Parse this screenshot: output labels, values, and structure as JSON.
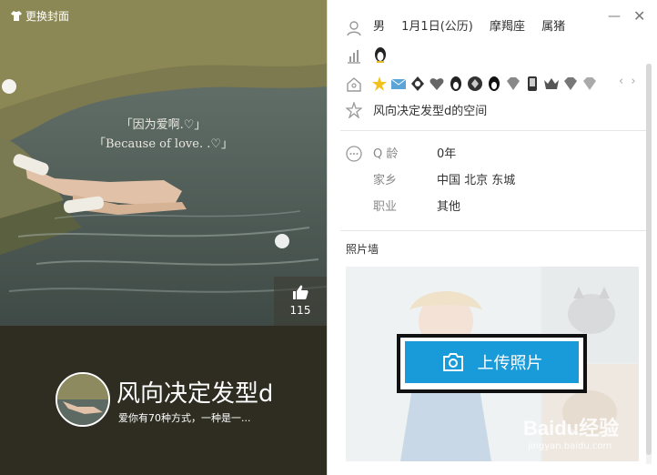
{
  "cover": {
    "change_cover_label": "更换封面",
    "quote_line1": "「因为爱啊.♡」",
    "quote_line2": "「Because of love. .♡」",
    "like_count": "115",
    "nickname": "风向决定发型d",
    "signature": "爱你有70种方式，一种是一..."
  },
  "window": {
    "minimize": "—",
    "close": "✕"
  },
  "profile": {
    "gender": "男",
    "birthday": "1月1日(公历)",
    "zodiac": "摩羯座",
    "chinese_zodiac": "属猪",
    "space_link": "风向决定发型d的空间",
    "fields": [
      {
        "label": "Q 龄",
        "value": "0年"
      },
      {
        "label": "家乡",
        "value": "中国 北京 东城"
      },
      {
        "label": "职业",
        "value": "其他"
      }
    ]
  },
  "badges": {
    "items": [
      "star-badge",
      "mail-badge",
      "penguin-badge",
      "heart-badge",
      "penguin-badge",
      "diamond-badge",
      "penguin-badge",
      "diamond-badge",
      "phone-badge",
      "crown-badge",
      "diamond-badge",
      "diamond-badge"
    ],
    "prev": "‹",
    "next": "›"
  },
  "photos": {
    "title": "照片墙",
    "upload_label": "上传照片"
  },
  "watermark": {
    "brand": "Baidu经验",
    "url": "jingyan.baidu.com"
  },
  "colors": {
    "accent": "#1a9bd9",
    "cover_band": "#2f2d22"
  }
}
